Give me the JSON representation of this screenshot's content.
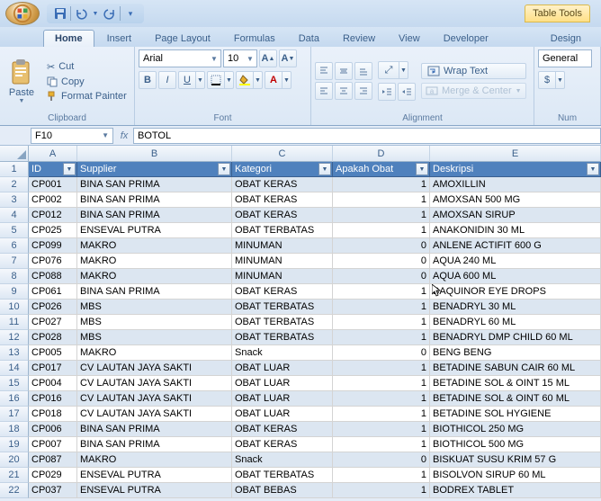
{
  "qat": {
    "save": "save-icon",
    "undo": "undo-icon",
    "redo": "redo-icon"
  },
  "context_tab": "Table Tools",
  "tabs": [
    "Home",
    "Insert",
    "Page Layout",
    "Formulas",
    "Data",
    "Review",
    "View",
    "Developer",
    "Design"
  ],
  "active_tab": "Home",
  "ribbon": {
    "clipboard": {
      "label": "Clipboard",
      "paste": "Paste",
      "cut": "Cut",
      "copy": "Copy",
      "format_painter": "Format Painter"
    },
    "font": {
      "label": "Font",
      "name": "Arial",
      "size": "10",
      "bold": "B",
      "italic": "I",
      "underline": "U"
    },
    "alignment": {
      "label": "Alignment",
      "wrap": "Wrap Text",
      "merge": "Merge & Center"
    },
    "number": {
      "label": "Num",
      "format": "General"
    }
  },
  "namebox": "F10",
  "formula": "BOTOL",
  "columns": [
    "A",
    "B",
    "C",
    "D",
    "E"
  ],
  "headers": [
    "ID",
    "Supplier",
    "Kategori",
    "Apakah Obat",
    "Deskripsi"
  ],
  "rows": [
    {
      "n": 2,
      "id": "CP001",
      "sup": "BINA SAN PRIMA",
      "kat": "OBAT KERAS",
      "flag": "1",
      "desc": "AMOXILLIN"
    },
    {
      "n": 3,
      "id": "CP002",
      "sup": "BINA SAN PRIMA",
      "kat": "OBAT KERAS",
      "flag": "1",
      "desc": "AMOXSAN 500 MG"
    },
    {
      "n": 4,
      "id": "CP012",
      "sup": "BINA SAN PRIMA",
      "kat": "OBAT KERAS",
      "flag": "1",
      "desc": "AMOXSAN SIRUP"
    },
    {
      "n": 5,
      "id": "CP025",
      "sup": "ENSEVAL PUTRA",
      "kat": "OBAT TERBATAS",
      "flag": "1",
      "desc": "ANAKONIDIN 30 ML"
    },
    {
      "n": 6,
      "id": "CP099",
      "sup": "MAKRO",
      "kat": "MINUMAN",
      "flag": "0",
      "desc": "ANLENE ACTIFIT 600 G"
    },
    {
      "n": 7,
      "id": "CP076",
      "sup": "MAKRO",
      "kat": "MINUMAN",
      "flag": "0",
      "desc": "AQUA 240 ML"
    },
    {
      "n": 8,
      "id": "CP088",
      "sup": "MAKRO",
      "kat": "MINUMAN",
      "flag": "0",
      "desc": "AQUA 600 ML"
    },
    {
      "n": 9,
      "id": "CP061",
      "sup": "BINA SAN PRIMA",
      "kat": "OBAT KERAS",
      "flag": "1",
      "desc": "BAQUINOR EYE DROPS"
    },
    {
      "n": 10,
      "id": "CP026",
      "sup": "MBS",
      "kat": "OBAT TERBATAS",
      "flag": "1",
      "desc": "BENADRYL 30 ML"
    },
    {
      "n": 11,
      "id": "CP027",
      "sup": "MBS",
      "kat": "OBAT TERBATAS",
      "flag": "1",
      "desc": "BENADRYL 60 ML"
    },
    {
      "n": 12,
      "id": "CP028",
      "sup": "MBS",
      "kat": "OBAT TERBATAS",
      "flag": "1",
      "desc": "BENADRYL DMP CHILD 60 ML"
    },
    {
      "n": 13,
      "id": "CP005",
      "sup": "MAKRO",
      "kat": "Snack",
      "flag": "0",
      "desc": "BENG BENG"
    },
    {
      "n": 14,
      "id": "CP017",
      "sup": "CV LAUTAN JAYA SAKTI",
      "kat": "OBAT LUAR",
      "flag": "1",
      "desc": "BETADINE SABUN CAIR 60 ML"
    },
    {
      "n": 15,
      "id": "CP004",
      "sup": "CV LAUTAN JAYA SAKTI",
      "kat": "OBAT LUAR",
      "flag": "1",
      "desc": "BETADINE SOL & OINT 15 ML"
    },
    {
      "n": 16,
      "id": "CP016",
      "sup": "CV LAUTAN JAYA SAKTI",
      "kat": "OBAT LUAR",
      "flag": "1",
      "desc": "BETADINE SOL & OINT 60 ML"
    },
    {
      "n": 17,
      "id": "CP018",
      "sup": "CV LAUTAN JAYA SAKTI",
      "kat": "OBAT LUAR",
      "flag": "1",
      "desc": "BETADINE SOL HYGIENE"
    },
    {
      "n": 18,
      "id": "CP006",
      "sup": "BINA SAN PRIMA",
      "kat": "OBAT KERAS",
      "flag": "1",
      "desc": "BIOTHICOL 250 MG"
    },
    {
      "n": 19,
      "id": "CP007",
      "sup": "BINA SAN PRIMA",
      "kat": "OBAT KERAS",
      "flag": "1",
      "desc": "BIOTHICOL 500 MG"
    },
    {
      "n": 20,
      "id": "CP087",
      "sup": "MAKRO",
      "kat": "Snack",
      "flag": "0",
      "desc": "BISKUAT SUSU KRIM 57 G"
    },
    {
      "n": 21,
      "id": "CP029",
      "sup": "ENSEVAL PUTRA",
      "kat": "OBAT TERBATAS",
      "flag": "1",
      "desc": "BISOLVON SIRUP 60 ML"
    },
    {
      "n": 22,
      "id": "CP037",
      "sup": "ENSEVAL PUTRA",
      "kat": "OBAT BEBAS",
      "flag": "1",
      "desc": "BODREX TABLET"
    }
  ]
}
